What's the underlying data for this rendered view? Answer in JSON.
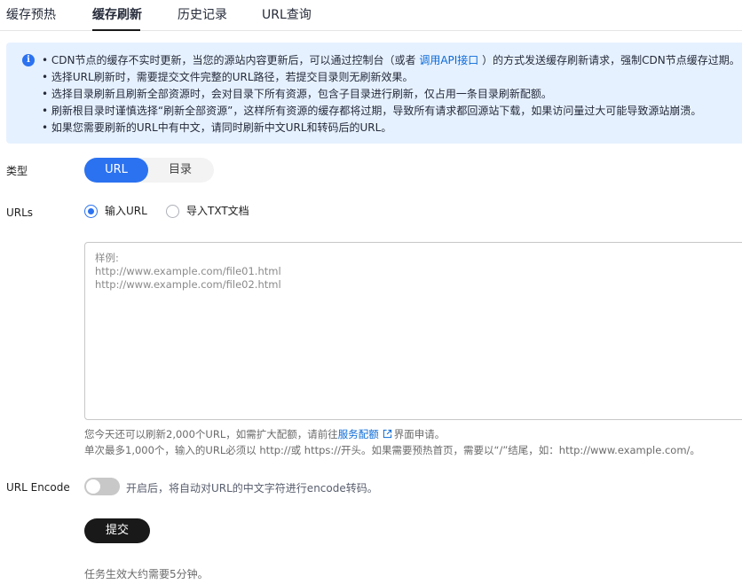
{
  "tabs": [
    {
      "label": "缓存预热",
      "active": false
    },
    {
      "label": "缓存刷新",
      "active": true
    },
    {
      "label": "历史记录",
      "active": false
    },
    {
      "label": "URL查询",
      "active": false
    }
  ],
  "info": {
    "line1_pre": "• CDN节点的缓存不实时更新，当您的源站内容更新后，可以通过控制台（或者 ",
    "line1_link": "调用API接口",
    "line1_post": " ）的方式发送缓存刷新请求，强制CDN节点缓存过期。",
    "line2": "• 选择URL刷新时，需要提交文件完整的URL路径，若提交目录则无刷新效果。",
    "line3": "• 选择目录刷新且刷新全部资源时，会对目录下所有资源，包含子目录进行刷新，仅占用一条目录刷新配额。",
    "line4": "• 刷新根目录时谨慎选择“刷新全部资源”，这样所有资源的缓存都将过期，导致所有请求都回源站下载，如果访问量过大可能导致源站崩溃。",
    "line5": "• 如果您需要刷新的URL中有中文，请同时刷新中文URL和转码后的URL。",
    "accent_color": "#2b72f0",
    "background_color": "#e6f1ff"
  },
  "form": {
    "type_label": "类型",
    "type_options": [
      "URL",
      "目录"
    ],
    "type_selected": "URL",
    "urls_label": "URLs",
    "radio_input_label": "输入URL",
    "radio_import_label": "导入TXT文档",
    "radio_selected": "输入URL",
    "textarea_placeholder": "样例:\nhttp://www.example.com/file01.html\nhttp://www.example.com/file02.html",
    "hint1_pre": "您今天还可以刷新2,000个URL，如需扩大配额，请前往",
    "hint1_link": "服务配额",
    "hint1_post": "界面申请。",
    "hint2": "单次最多1,000个，输入的URL必须以 http://或 https://开头。如果需要预热首页，需要以“/”结尾，如：http://www.example.com/。",
    "encode_label": "URL Encode",
    "encode_enabled": false,
    "encode_desc": "开启后，将自动对URL的中文字符进行encode转码。",
    "submit_label": "提交",
    "footnote": "任务生效大约需要5分钟。"
  },
  "icons": {
    "info": "info-circle-icon",
    "external_link": "external-link-icon"
  }
}
